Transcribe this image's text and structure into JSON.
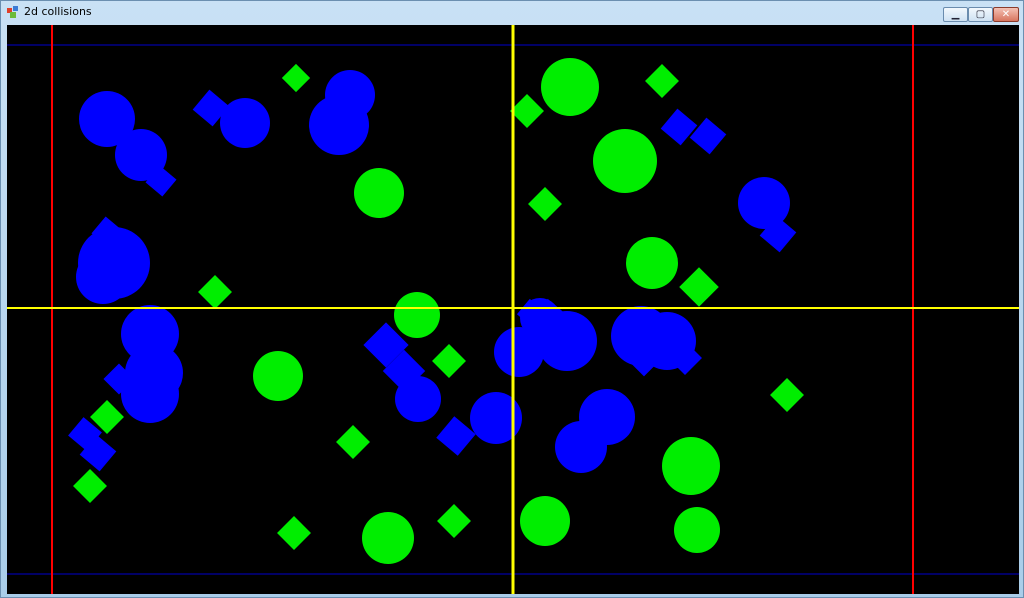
{
  "window": {
    "title": "2d collisions"
  },
  "icons": {
    "app": "app-icon",
    "minimize": "minimize-icon",
    "maximize": "maximize-icon",
    "close": "close-icon"
  },
  "controls": {
    "minimize": "▁",
    "maximize": "▢",
    "close": "✕"
  },
  "colors": {
    "background": "#000000",
    "body_blue": "#0000ff",
    "body_green": "#00ee00",
    "bounds_red": "#ff0000",
    "split_yellow": "#ffff00",
    "bounds_blue": "#0000cc"
  }
}
